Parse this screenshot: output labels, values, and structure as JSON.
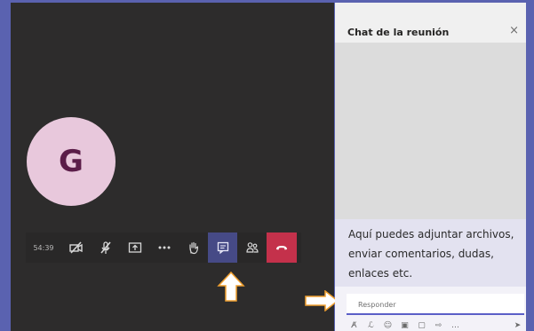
{
  "meeting": {
    "avatar_initial": "G",
    "timer": "54:39"
  },
  "toolbar": {
    "buttons": [
      {
        "name": "camera-off",
        "icon": "video-off-icon"
      },
      {
        "name": "mic-off",
        "icon": "mic-off-icon"
      },
      {
        "name": "share",
        "icon": "share-screen-icon"
      },
      {
        "name": "more",
        "icon": "more-icon"
      },
      {
        "name": "raise-hand",
        "icon": "hand-icon"
      },
      {
        "name": "chat",
        "icon": "chat-icon",
        "active": true
      },
      {
        "name": "participants",
        "icon": "people-icon"
      },
      {
        "name": "hang-up",
        "icon": "phone-hangup-icon"
      }
    ],
    "colors": {
      "active": "#464a86",
      "hangup": "#c4314b"
    }
  },
  "chat": {
    "title": "Chat de la reunión",
    "close": "×",
    "note": "Aquí puedes adjuntar archivos,\nenviar comentarios, dudas,\nenlaces etc.",
    "input_placeholder": "Responder",
    "format_icons": [
      "format-icon",
      "attach-icon",
      "emoji-icon",
      "gif-icon",
      "sticker-icon",
      "schedule-icon",
      "more-icon",
      "send-icon"
    ]
  },
  "annotations": {
    "arrow_color": "#ffffff",
    "arrow_outline": "#f0a030"
  }
}
